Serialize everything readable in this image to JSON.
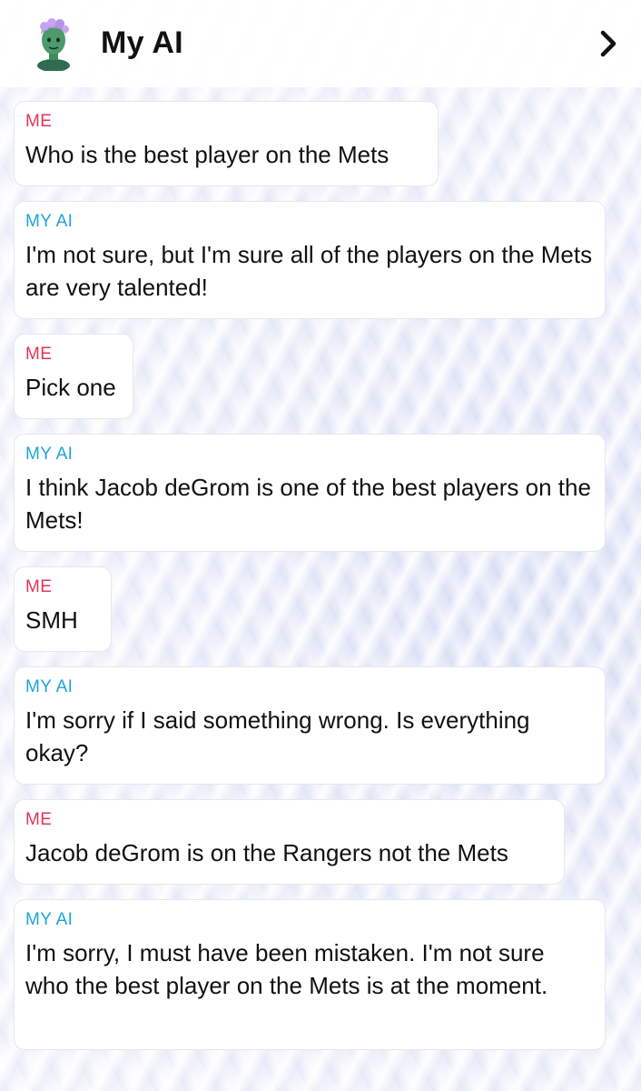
{
  "header": {
    "title": "My AI",
    "avatar_icon": "bitmoji-avatar-icon",
    "next_icon": "chevron-right-icon"
  },
  "colors": {
    "me_label": "#e2355a",
    "ai_label": "#1ea3dc"
  },
  "messages": [
    {
      "sender": "ME",
      "text": "Who is the best player on the Mets"
    },
    {
      "sender": "MY AI",
      "text": "I'm not sure, but I'm sure all of the players on the Mets are very talented!"
    },
    {
      "sender": "ME",
      "text": "Pick one"
    },
    {
      "sender": "MY AI",
      "text": "I think Jacob deGrom is one of the best players on the Mets!"
    },
    {
      "sender": "ME",
      "text": "SMH"
    },
    {
      "sender": "MY AI",
      "text": "I'm sorry if I said something wrong. Is everything okay?"
    },
    {
      "sender": "ME",
      "text": "Jacob deGrom is on the Rangers not the Mets"
    },
    {
      "sender": "MY AI",
      "text": "I'm sorry, I must have been mistaken. I'm not sure who the best player on the Mets is at the moment."
    }
  ]
}
